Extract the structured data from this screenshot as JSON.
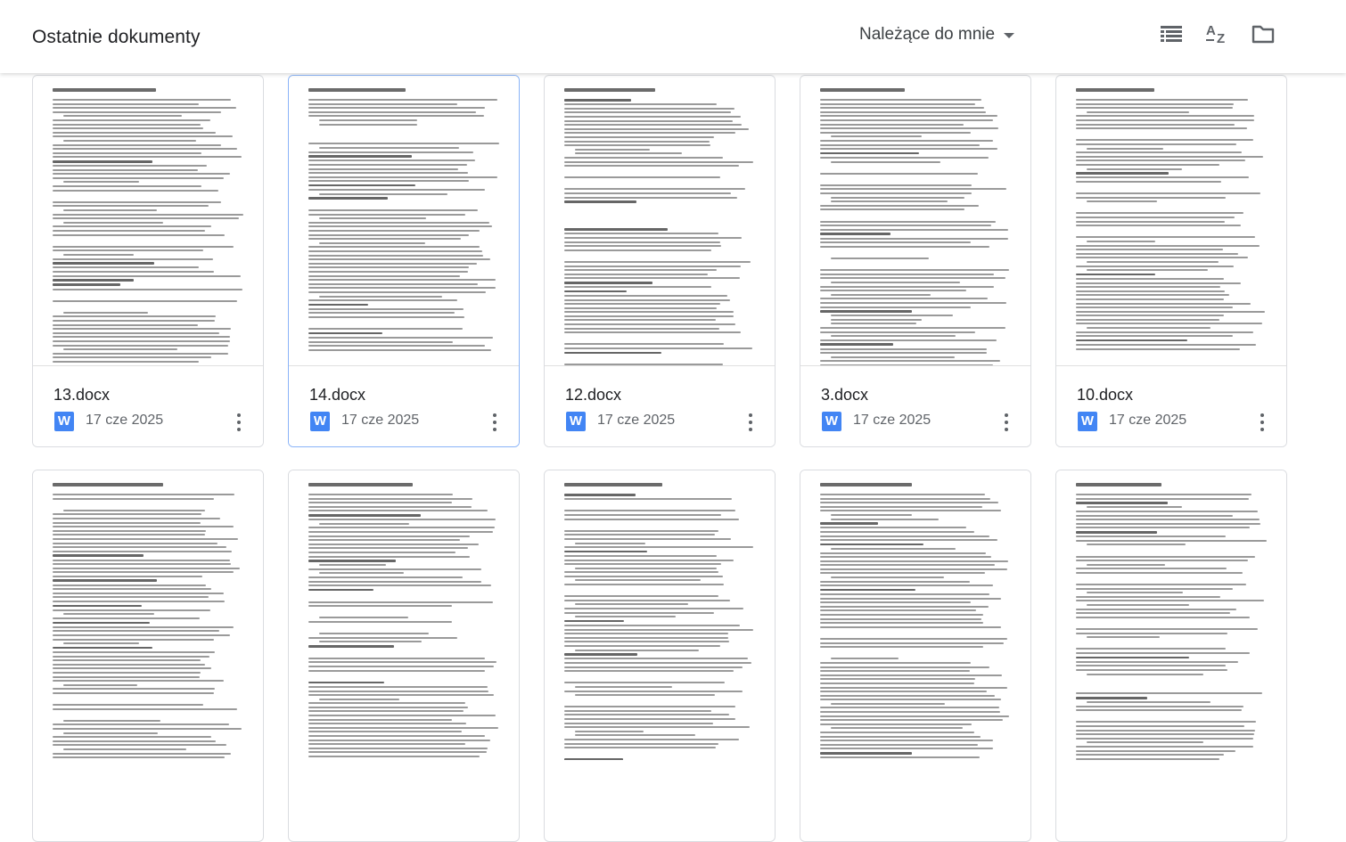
{
  "header": {
    "title": "Ostatnie dokumenty",
    "owner_filter": "Należące do mnie",
    "icons": [
      "list-view-icon",
      "sort-az-icon",
      "folder-icon"
    ]
  },
  "colors": {
    "word_icon": "#4285f4",
    "selected_border": "#8ab4f8"
  },
  "row1": [
    {
      "name": "13.docx",
      "date": "17 cze 2025",
      "icon_letter": "W"
    },
    {
      "name": "14.docx",
      "date": "17 cze 2025",
      "icon_letter": "W"
    },
    {
      "name": "12.docx",
      "date": "17 cze 2025",
      "icon_letter": "W"
    },
    {
      "name": "3.docx",
      "date": "17 cze 2025",
      "icon_letter": "W"
    },
    {
      "name": "10.docx",
      "date": "17 cze 2025",
      "icon_letter": "W"
    }
  ]
}
